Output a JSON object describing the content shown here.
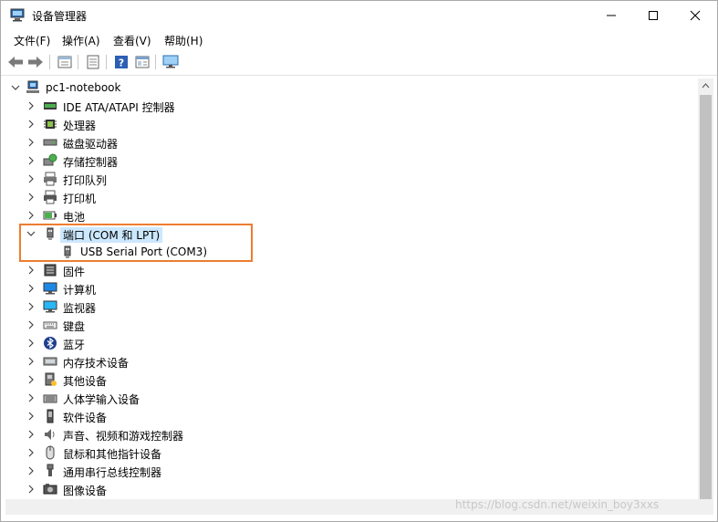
{
  "window": {
    "title": "设备管理器",
    "controls": {
      "minimize": "—",
      "maximize": "☐",
      "close": "✕"
    }
  },
  "menu": [
    {
      "label": "文件(F)"
    },
    {
      "label": "操作(A)"
    },
    {
      "label": "查看(V)"
    },
    {
      "label": "帮助(H)"
    }
  ],
  "toolbar": [
    "back-icon",
    "forward-icon",
    "properties-icon",
    "update-driver-icon",
    "help-icon",
    "scan-icon",
    "display-icon"
  ],
  "tree": {
    "root": "pc1-notebook",
    "items": [
      {
        "label": "IDE ATA/ATAPI 控制器",
        "icon": "ide-controller-icon",
        "expanded": false
      },
      {
        "label": "处理器",
        "icon": "processor-icon",
        "expanded": false
      },
      {
        "label": "磁盘驱动器",
        "icon": "disk-drive-icon",
        "expanded": false
      },
      {
        "label": "存储控制器",
        "icon": "storage-controller-icon",
        "expanded": false
      },
      {
        "label": "打印队列",
        "icon": "print-queue-icon",
        "expanded": false
      },
      {
        "label": "打印机",
        "icon": "printer-icon",
        "expanded": false
      },
      {
        "label": "电池",
        "icon": "battery-icon",
        "expanded": false
      },
      {
        "label": "端口 (COM 和 LPT)",
        "icon": "port-icon",
        "expanded": true,
        "selected": true,
        "children": [
          {
            "label": "USB Serial Port (COM3)",
            "icon": "port-icon"
          }
        ]
      },
      {
        "label": "固件",
        "icon": "firmware-icon",
        "expanded": false
      },
      {
        "label": "计算机",
        "icon": "computer-icon",
        "expanded": false
      },
      {
        "label": "监视器",
        "icon": "monitor-icon",
        "expanded": false
      },
      {
        "label": "键盘",
        "icon": "keyboard-icon",
        "expanded": false
      },
      {
        "label": "蓝牙",
        "icon": "bluetooth-icon",
        "expanded": false
      },
      {
        "label": "内存技术设备",
        "icon": "memory-device-icon",
        "expanded": false
      },
      {
        "label": "其他设备",
        "icon": "other-devices-icon",
        "expanded": false
      },
      {
        "label": "人体学输入设备",
        "icon": "hid-icon",
        "expanded": false
      },
      {
        "label": "软件设备",
        "icon": "software-device-icon",
        "expanded": false
      },
      {
        "label": "声音、视频和游戏控制器",
        "icon": "sound-icon",
        "expanded": false
      },
      {
        "label": "鼠标和其他指针设备",
        "icon": "mouse-icon",
        "expanded": false
      },
      {
        "label": "通用串行总线控制器",
        "icon": "usb-controller-icon",
        "expanded": false
      },
      {
        "label": "图像设备",
        "icon": "imaging-device-icon",
        "expanded": false
      }
    ]
  },
  "watermark": "https://blog.csdn.net/weixin_boy3xxs",
  "colors": {
    "highlight_box": "#ed7d31",
    "selection": "#cce8ff"
  }
}
